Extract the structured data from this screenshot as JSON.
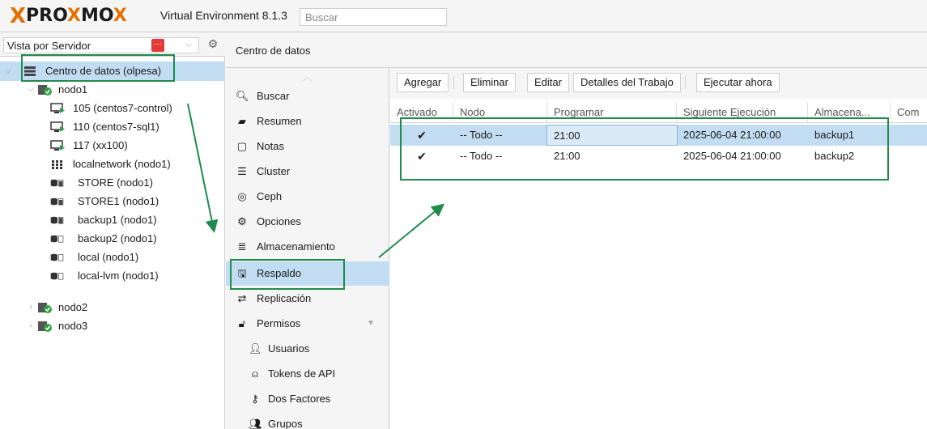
{
  "header": {
    "logo_x": "X",
    "logo_pro": "PRO",
    "logo_x2": "X",
    "logo_mo": "MO",
    "version": "Virtual Environment 8.1.3",
    "search_placeholder": "Buscar"
  },
  "sidebar": {
    "view_label": "Vista por Servidor",
    "badge": "···",
    "tree": [
      {
        "label": "Centro de datos (olpesa)",
        "icon": "datacenter-icon"
      },
      {
        "label": "nodo1",
        "icon": "node-online-icon"
      },
      {
        "label": "105 (centos7-control)",
        "icon": "vm-running-icon"
      },
      {
        "label": "110 (centos7-sql1)",
        "icon": "vm-running-icon"
      },
      {
        "label": "117 (xx100)",
        "icon": "vm-icon"
      },
      {
        "label": "localnetwork (nodo1)",
        "icon": "network-grid-icon"
      },
      {
        "label": "STORE (nodo1)",
        "icon": "storage-icon"
      },
      {
        "label": "STORE1 (nodo1)",
        "icon": "storage-icon"
      },
      {
        "label": "backup1 (nodo1)",
        "icon": "storage-icon"
      },
      {
        "label": "backup2 (nodo1)",
        "icon": "storage-icon"
      },
      {
        "label": "local (nodo1)",
        "icon": "storage-icon"
      },
      {
        "label": "local-lvm (nodo1)",
        "icon": "storage-icon"
      },
      {
        "label": "nodo2",
        "icon": "node-online-icon"
      },
      {
        "label": "nodo3",
        "icon": "node-online-icon"
      }
    ]
  },
  "main": {
    "title": "Centro de datos",
    "nav": [
      {
        "label": "Buscar",
        "icon": "search-icon"
      },
      {
        "label": "Resumen",
        "icon": "book-icon"
      },
      {
        "label": "Notas",
        "icon": "note-icon"
      },
      {
        "label": "Cluster",
        "icon": "server-icon"
      },
      {
        "label": "Ceph",
        "icon": "ceph-icon"
      },
      {
        "label": "Opciones",
        "icon": "gear-icon"
      },
      {
        "label": "Almacenamiento",
        "icon": "database-icon"
      },
      {
        "label": "Respaldo",
        "icon": "floppy-icon"
      },
      {
        "label": "Replicación",
        "icon": "retweet-icon"
      },
      {
        "label": "Permisos",
        "icon": "unlock-icon"
      },
      {
        "label": "Usuarios",
        "icon": "user-icon"
      },
      {
        "label": "Tokens de API",
        "icon": "user-outline-icon"
      },
      {
        "label": "Dos Factores",
        "icon": "key-icon"
      },
      {
        "label": "Grupos",
        "icon": "users-icon"
      }
    ],
    "toolbar": {
      "add": "Agregar",
      "remove": "Eliminar",
      "edit": "Editar",
      "details": "Detalles del Trabajo",
      "run_now": "Ejecutar ahora"
    },
    "columns": [
      "Activado",
      "Nodo",
      "Programar",
      "Siguiente Ejecución",
      "Almacena...",
      "Com"
    ],
    "rows": [
      {
        "enabled": "✔",
        "node": "-- Todo --",
        "schedule": "21:00",
        "next_run": "2025-06-04 21:00:00",
        "storage": "backup1"
      },
      {
        "enabled": "✔",
        "node": "-- Todo --",
        "schedule": "21:00",
        "next_run": "2025-06-04 21:00:00",
        "storage": "backup2"
      }
    ]
  },
  "colors": {
    "brand_orange": "#e57000",
    "selection": "#c2ddf2",
    "annotation_green": "#1f8b4c"
  }
}
